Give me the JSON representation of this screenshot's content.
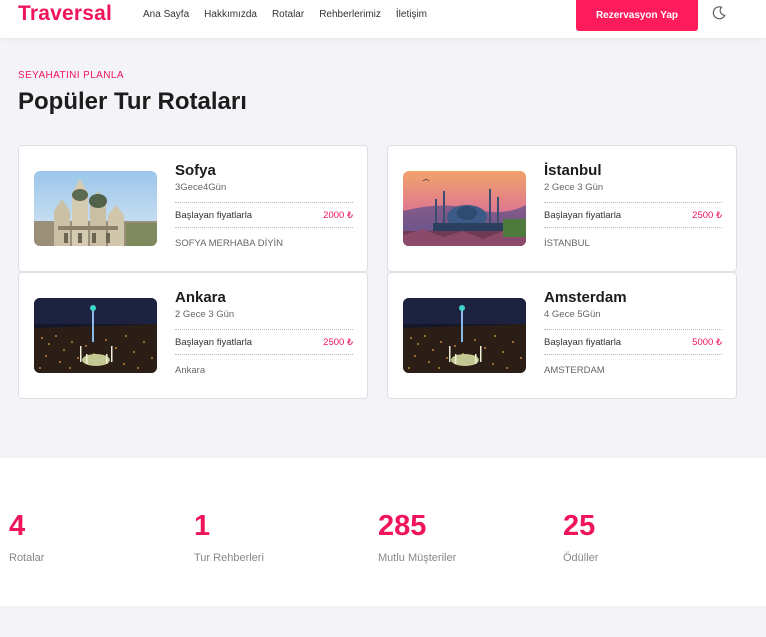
{
  "header": {
    "brand": "Traversal",
    "nav": [
      "Ana Sayfa",
      "Hakkımızda",
      "Rotalar",
      "Rehberlerimiz",
      "İletişim"
    ],
    "cta_label": "Rezervasyon Yap",
    "theme_icon": "moon-icon"
  },
  "section": {
    "eyebrow": "SEYAHATINI PLANLA",
    "title": "Popüler Tur Rotaları"
  },
  "routes": [
    {
      "name": "Sofya",
      "duration": "3Gece4Gün",
      "price_label": "Başlayan fiyatlarla",
      "price": "2000 ₺",
      "description": "SOFYA MERHABA DİYİN",
      "image": "sofya-cathedral"
    },
    {
      "name": "İstanbul",
      "duration": "2 Gece 3 Gün",
      "price_label": "Başlayan fiyatlarla",
      "price": "2500 ₺",
      "description": "İSTANBUL",
      "image": "istanbul-mosque"
    },
    {
      "name": "Ankara",
      "duration": "2 Gece 3 Gün",
      "price_label": "Başlayan fiyatlarla",
      "price": "2500 ₺",
      "description": "Ankara",
      "image": "ankara-night"
    },
    {
      "name": "Amsterdam",
      "duration": "4 Gece 5Gün",
      "price_label": "Başlayan fiyatlarla",
      "price": "5000 ₺",
      "description": "AMSTERDAM",
      "image": "ankara-night"
    }
  ],
  "stats": [
    {
      "value": "4",
      "label": "Rotalar"
    },
    {
      "value": "1",
      "label": "Tur Rehberleri"
    },
    {
      "value": "285",
      "label": "Mutlu Müşteriler"
    },
    {
      "value": "25",
      "label": "Ödüller"
    }
  ],
  "colors": {
    "accent": "#f0145a",
    "cta": "#ff1b5c",
    "background": "#f4f4f8"
  }
}
